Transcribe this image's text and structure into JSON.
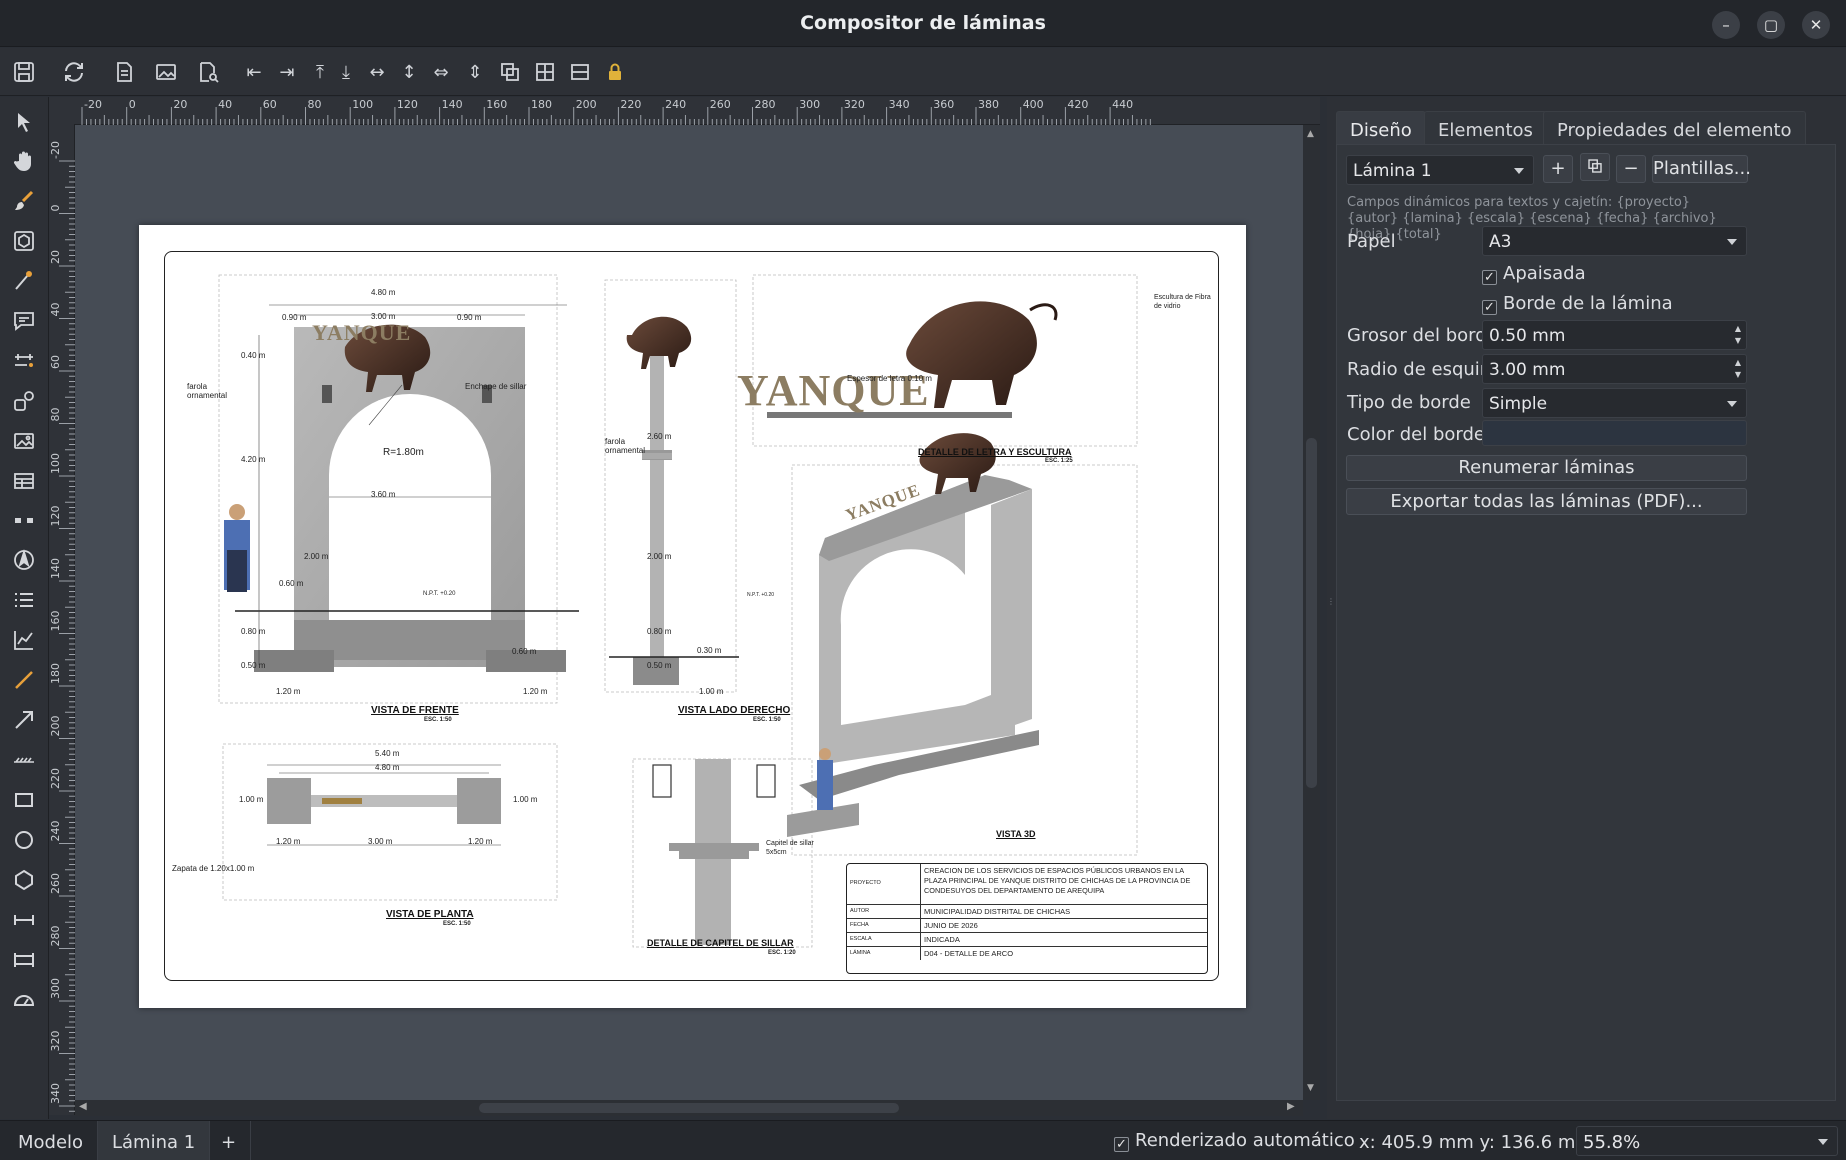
{
  "window": {
    "title": "Compositor de láminas",
    "controls": [
      "–",
      "▢",
      "✕"
    ]
  },
  "ruler": {
    "top_ticks": [
      "-20",
      "0",
      "20",
      "40",
      "60",
      "80",
      "100",
      "120",
      "140",
      "160",
      "180",
      "200",
      "220",
      "240",
      "260",
      "280",
      "300",
      "320",
      "340",
      "360",
      "380",
      "400",
      "420",
      "440"
    ],
    "left_ticks": [
      "-20",
      "0",
      "20",
      "40",
      "60",
      "80",
      "100",
      "120",
      "140",
      "160",
      "180",
      "200",
      "220",
      "240",
      "260",
      "280",
      "300",
      "320",
      "340"
    ]
  },
  "sheet": {
    "views": {
      "front": {
        "label": "VISTA DE FRENTE",
        "scale": "ESC. 1:50"
      },
      "side": {
        "label": "VISTA LADO DERECHO",
        "scale": "ESC. 1:50"
      },
      "letter_detail": {
        "label": "DETALLE DE LETRA Y ESCULTURA",
        "scale": "ESC. 1:25"
      },
      "view3d": {
        "label": "VISTA 3D"
      },
      "plan": {
        "label": "VISTA DE PLANTA",
        "scale": "ESC. 1:50"
      },
      "capitel": {
        "label": "DETALLE DE CAPITEL DE SILLAR",
        "scale": "ESC. 1:20"
      }
    },
    "brand_text": "YANQUE",
    "annotations": {
      "front_width": "4.80 m",
      "front_inner": "3.00 m",
      "front_side_left": "0.90 m",
      "front_side_right": "0.90 m",
      "front_top": "0.40 m",
      "farola": "farola ornamental",
      "enchape": "Enchape de sillar",
      "radius": "R=1.80m",
      "height_420": "4.20 m",
      "span_360": "3.60 m",
      "h_200": "2.00 m",
      "w_060": "0.60 m",
      "npt": "N.P.T. +0.20",
      "h_080": "0.80 m",
      "h_050": "0.50 m",
      "w_120": "1.20 m",
      "h_260": "2.60 m",
      "w_030": "0.30 m",
      "w_100": "1.00 m",
      "espesor": "Espesor de letra 0.10 m",
      "escultura": "Escultura de Fibra de vidrio",
      "plan_540": "5.40 m",
      "plan_480": "4.80 m",
      "plan_100": "1.00 m",
      "plan_300": "3.00 m",
      "zapata": "Zapata de 1.20x1.00 m",
      "capitel_note": "Capitel de sillar 5x5cm"
    },
    "title_block": {
      "rows": [
        {
          "key": "PROYECTO",
          "value": "CREACION DE LOS SERVICIOS DE ESPACIOS PÚBLICOS URBANOS EN LA PLAZA PRINCIPAL DE YANQUE DISTRITO DE CHICHAS DE LA PROVINCIA DE CONDESUYOS DEL DEPARTAMENTO DE AREQUIPA"
        },
        {
          "key": "AUTOR",
          "value": "MUNICIPALIDAD DISTRITAL DE CHICHAS"
        },
        {
          "key": "FECHA",
          "value": "JUNIO DE 2026"
        },
        {
          "key": "ESCALA",
          "value": "INDICADA"
        },
        {
          "key": "LÁMINA",
          "value": "D04 - DETALLE DE ARCO"
        }
      ]
    }
  },
  "panel": {
    "tabs": [
      "Diseño",
      "Elementos",
      "Propiedades del elemento"
    ],
    "sheet_select": "Lámina 1",
    "add_label": "+",
    "remove_label": "−",
    "templates_label": "Plantillas...",
    "hint": "Campos dinámicos para textos y cajetín: {proyecto} {autor} {lamina} {escala} {escena} {fecha} {archivo} {hoja} {total}",
    "paper_label": "Papel",
    "paper_value": "A3",
    "landscape_label": "Apaisada",
    "border_label": "Borde de la lámina",
    "border_width_label": "Grosor del borde",
    "border_width_value": "0.50 mm",
    "corner_radius_label": "Radio de esquinas",
    "corner_radius_value": "3.00 mm",
    "border_type_label": "Tipo de borde",
    "border_type_value": "Simple",
    "border_color_label": "Color del borde",
    "border_color": "#2c3440",
    "renumber_label": "Renumerar láminas",
    "export_label": "Exportar todas las láminas (PDF)..."
  },
  "bottom": {
    "tabs": [
      "Modelo",
      "Lámina 1"
    ],
    "add_tab": "+",
    "auto_render_label": "Renderizado automático",
    "coords": "x: 405.9 mm  y: 136.6 mm",
    "zoom": "55.8%"
  }
}
